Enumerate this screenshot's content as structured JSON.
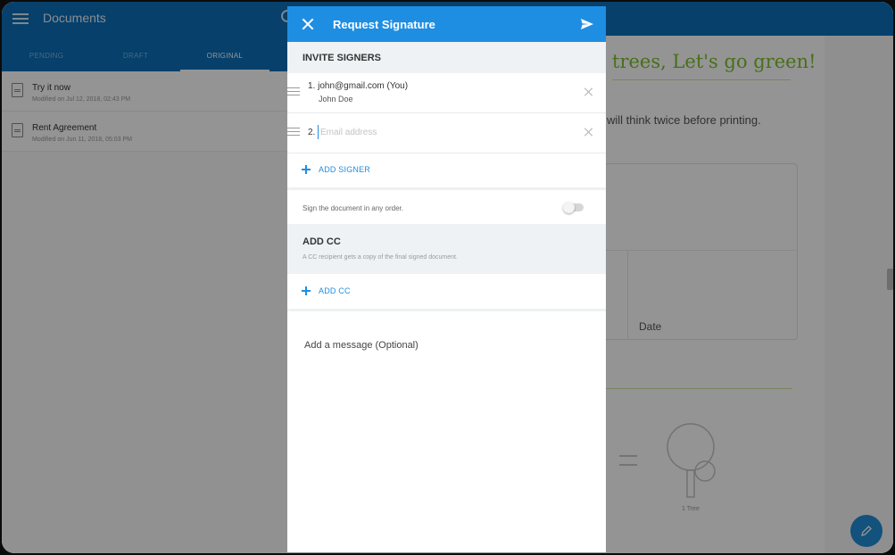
{
  "background": {
    "app_title": "Documents",
    "tabs": [
      {
        "label": "PENDING"
      },
      {
        "label": "DRAFT"
      },
      {
        "label": "ORIGINAL"
      }
    ],
    "documents": [
      {
        "name": "Try it now",
        "meta": "Modified on Jul 12, 2018, 02:43 PM"
      },
      {
        "name": "Rent Agreement",
        "meta": "Modified on Jun 11, 2018, 05:03 PM"
      }
    ],
    "doc_heading": "trees, Let's go green!",
    "doc_body": "will think twice before printing.",
    "date_label": "Date",
    "tree_label": "1 Tree"
  },
  "dialog": {
    "title": "Request Signature",
    "invite_heading": "INVITE SIGNERS",
    "signers": [
      {
        "line": "1. john@gmail.com (You)",
        "name": "John Doe"
      },
      {
        "number": "2.",
        "placeholder": "Email address",
        "value": ""
      }
    ],
    "add_signer_label": "ADD SIGNER",
    "order_text": "Sign the document in any order.",
    "order_toggle_on": false,
    "cc_heading": "ADD CC",
    "cc_subtitle": "A CC recipient gets a copy of the final signed document.",
    "add_cc_label": "ADD CC",
    "message_placeholder": "Add a message (Optional)"
  },
  "colors": {
    "header_blue": "#1e8ee2",
    "app_bar_blue": "#0c6fb9",
    "link_blue": "#1e8ee2",
    "green_accent": "#7cbf2f"
  }
}
